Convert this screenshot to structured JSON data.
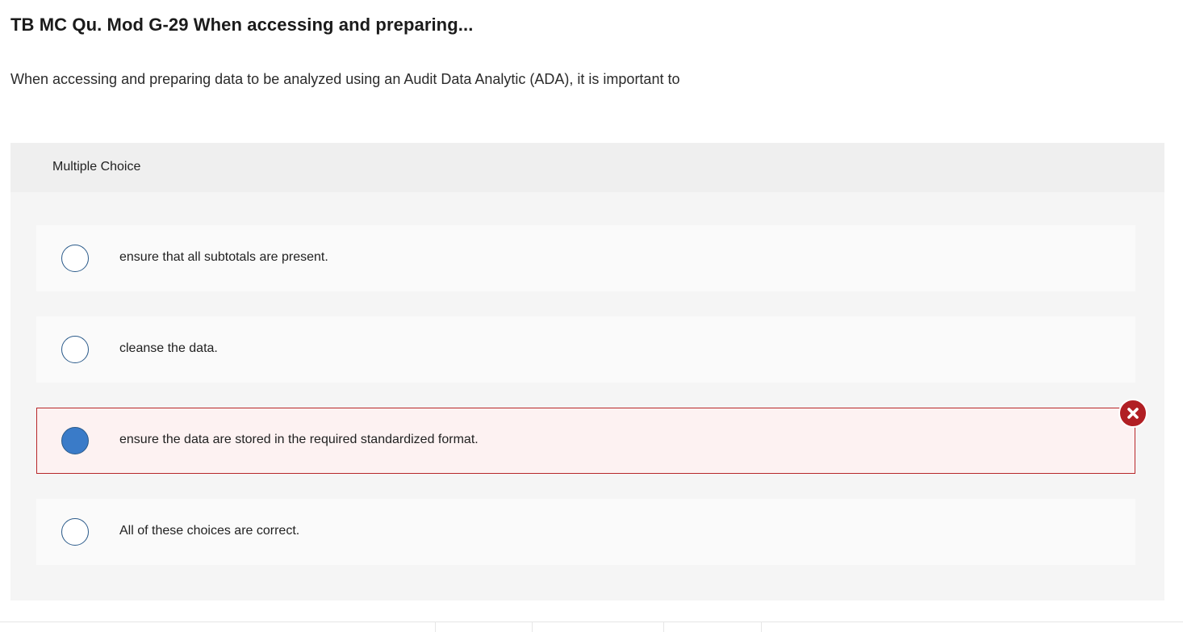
{
  "question": {
    "title": "TB MC Qu. Mod G-29 When accessing and preparing...",
    "prompt": "When accessing and preparing data to be analyzed using an Audit Data Analytic (ADA), it is important to"
  },
  "answer_panel": {
    "header_label": "Multiple Choice",
    "options": [
      {
        "label": "ensure that all subtotals are present.",
        "selected": false,
        "status": ""
      },
      {
        "label": "cleanse the data.",
        "selected": false,
        "status": ""
      },
      {
        "label": "ensure the data are stored in the required standardized format.",
        "selected": true,
        "status": "incorrect"
      },
      {
        "label": "All of these choices are correct.",
        "selected": false,
        "status": ""
      }
    ]
  },
  "icons": {
    "incorrect_badge": "close-x-icon"
  },
  "colors": {
    "incorrect": "#b11f24",
    "radio_selected": "#3a7bc8",
    "radio_border": "#2a5a8a",
    "incorrect_option_bg": "#fdf2f2"
  }
}
